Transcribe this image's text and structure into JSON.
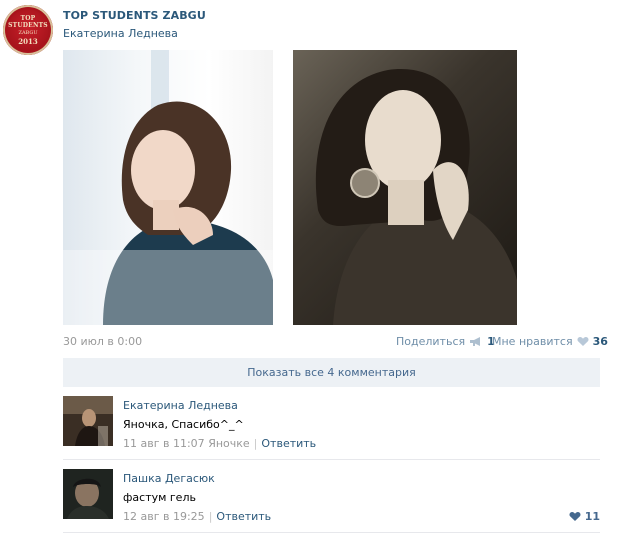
{
  "post": {
    "group_name": "TOP STUDENTS ZABGU",
    "author": "Екатерина Леднева",
    "logo": {
      "line1": "TOP STUDENTS",
      "line2": "ZABGU",
      "year": "2013",
      "colors": {
        "bg": "#a8141c",
        "text": "#f2e2c0"
      }
    },
    "date": "30 июл в 0:00",
    "share_label": "Поделиться",
    "share_count": "1",
    "like_label": "Мне нравится",
    "like_count": "36"
  },
  "comments_bar": {
    "label": "Показать все 4 комментария"
  },
  "comments": [
    {
      "name": "Екатерина Леднева",
      "text": "Яночка, Спасибо^_^",
      "time": "11 авг в 11:07",
      "reply_to": "Яночке",
      "reply_label": "Ответить",
      "likes": ""
    },
    {
      "name": "Пашка Дегасюк",
      "text": "фастум гель",
      "time": "12 авг в 19:25",
      "reply_to": "",
      "reply_label": "Ответить",
      "likes": "11"
    }
  ],
  "icons": {
    "share": "megaphone-icon",
    "like": "heart-icon"
  },
  "colors": {
    "link": "#2b587a",
    "muted": "#999999",
    "bar_bg": "#edf1f5",
    "action": "#6f8ea8"
  }
}
